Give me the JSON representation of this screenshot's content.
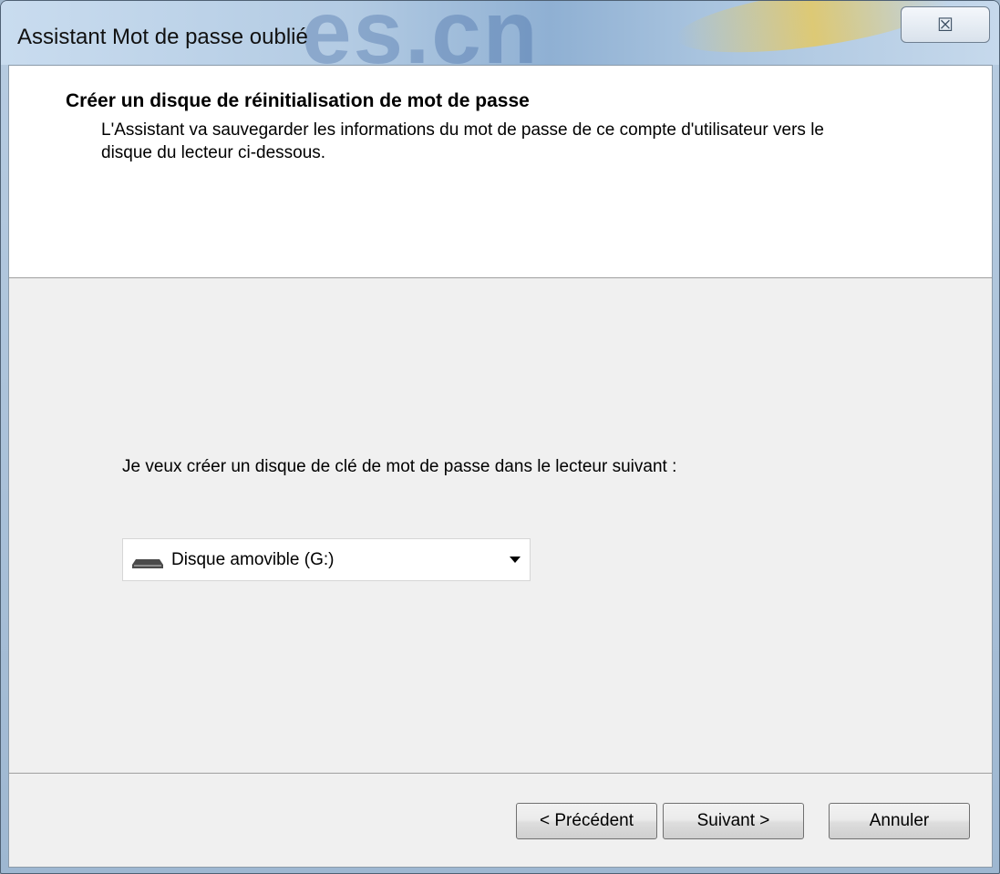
{
  "window": {
    "title": "Assistant Mot de passe oublié",
    "close_symbol": "☒",
    "watermark_text": "es.cn"
  },
  "header": {
    "title": "Créer un disque de réinitialisation de mot de passe",
    "description": "L'Assistant va sauvegarder les informations du mot de passe de ce compte d'utilisateur vers le disque du lecteur ci-dessous."
  },
  "main": {
    "prompt": "Je veux créer un disque de clé de mot de passe dans le lecteur suivant :",
    "drive_select": {
      "selected": "Disque amovible (G:)",
      "icon": "removable-drive-icon"
    }
  },
  "footer": {
    "prev_label": "< Précédent",
    "next_label": "Suivant >",
    "cancel_label": "Annuler"
  }
}
